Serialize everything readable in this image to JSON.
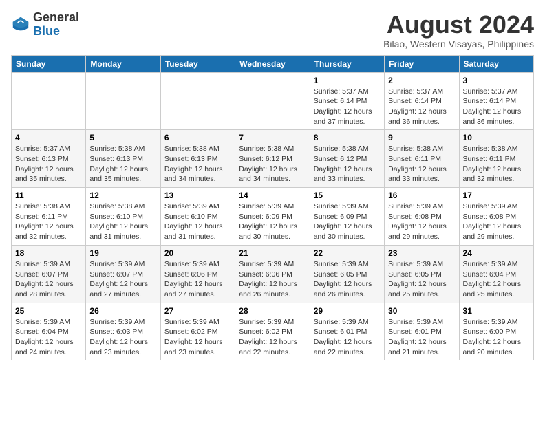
{
  "header": {
    "logo_general": "General",
    "logo_blue": "Blue",
    "title": "August 2024",
    "subtitle": "Bilao, Western Visayas, Philippines"
  },
  "calendar": {
    "days_of_week": [
      "Sunday",
      "Monday",
      "Tuesday",
      "Wednesday",
      "Thursday",
      "Friday",
      "Saturday"
    ],
    "weeks": [
      [
        {
          "day": "",
          "info": ""
        },
        {
          "day": "",
          "info": ""
        },
        {
          "day": "",
          "info": ""
        },
        {
          "day": "",
          "info": ""
        },
        {
          "day": "1",
          "info": "Sunrise: 5:37 AM\nSunset: 6:14 PM\nDaylight: 12 hours\nand 37 minutes."
        },
        {
          "day": "2",
          "info": "Sunrise: 5:37 AM\nSunset: 6:14 PM\nDaylight: 12 hours\nand 36 minutes."
        },
        {
          "day": "3",
          "info": "Sunrise: 5:37 AM\nSunset: 6:14 PM\nDaylight: 12 hours\nand 36 minutes."
        }
      ],
      [
        {
          "day": "4",
          "info": "Sunrise: 5:37 AM\nSunset: 6:13 PM\nDaylight: 12 hours\nand 35 minutes."
        },
        {
          "day": "5",
          "info": "Sunrise: 5:38 AM\nSunset: 6:13 PM\nDaylight: 12 hours\nand 35 minutes."
        },
        {
          "day": "6",
          "info": "Sunrise: 5:38 AM\nSunset: 6:13 PM\nDaylight: 12 hours\nand 34 minutes."
        },
        {
          "day": "7",
          "info": "Sunrise: 5:38 AM\nSunset: 6:12 PM\nDaylight: 12 hours\nand 34 minutes."
        },
        {
          "day": "8",
          "info": "Sunrise: 5:38 AM\nSunset: 6:12 PM\nDaylight: 12 hours\nand 33 minutes."
        },
        {
          "day": "9",
          "info": "Sunrise: 5:38 AM\nSunset: 6:11 PM\nDaylight: 12 hours\nand 33 minutes."
        },
        {
          "day": "10",
          "info": "Sunrise: 5:38 AM\nSunset: 6:11 PM\nDaylight: 12 hours\nand 32 minutes."
        }
      ],
      [
        {
          "day": "11",
          "info": "Sunrise: 5:38 AM\nSunset: 6:11 PM\nDaylight: 12 hours\nand 32 minutes."
        },
        {
          "day": "12",
          "info": "Sunrise: 5:38 AM\nSunset: 6:10 PM\nDaylight: 12 hours\nand 31 minutes."
        },
        {
          "day": "13",
          "info": "Sunrise: 5:39 AM\nSunset: 6:10 PM\nDaylight: 12 hours\nand 31 minutes."
        },
        {
          "day": "14",
          "info": "Sunrise: 5:39 AM\nSunset: 6:09 PM\nDaylight: 12 hours\nand 30 minutes."
        },
        {
          "day": "15",
          "info": "Sunrise: 5:39 AM\nSunset: 6:09 PM\nDaylight: 12 hours\nand 30 minutes."
        },
        {
          "day": "16",
          "info": "Sunrise: 5:39 AM\nSunset: 6:08 PM\nDaylight: 12 hours\nand 29 minutes."
        },
        {
          "day": "17",
          "info": "Sunrise: 5:39 AM\nSunset: 6:08 PM\nDaylight: 12 hours\nand 29 minutes."
        }
      ],
      [
        {
          "day": "18",
          "info": "Sunrise: 5:39 AM\nSunset: 6:07 PM\nDaylight: 12 hours\nand 28 minutes."
        },
        {
          "day": "19",
          "info": "Sunrise: 5:39 AM\nSunset: 6:07 PM\nDaylight: 12 hours\nand 27 minutes."
        },
        {
          "day": "20",
          "info": "Sunrise: 5:39 AM\nSunset: 6:06 PM\nDaylight: 12 hours\nand 27 minutes."
        },
        {
          "day": "21",
          "info": "Sunrise: 5:39 AM\nSunset: 6:06 PM\nDaylight: 12 hours\nand 26 minutes."
        },
        {
          "day": "22",
          "info": "Sunrise: 5:39 AM\nSunset: 6:05 PM\nDaylight: 12 hours\nand 26 minutes."
        },
        {
          "day": "23",
          "info": "Sunrise: 5:39 AM\nSunset: 6:05 PM\nDaylight: 12 hours\nand 25 minutes."
        },
        {
          "day": "24",
          "info": "Sunrise: 5:39 AM\nSunset: 6:04 PM\nDaylight: 12 hours\nand 25 minutes."
        }
      ],
      [
        {
          "day": "25",
          "info": "Sunrise: 5:39 AM\nSunset: 6:04 PM\nDaylight: 12 hours\nand 24 minutes."
        },
        {
          "day": "26",
          "info": "Sunrise: 5:39 AM\nSunset: 6:03 PM\nDaylight: 12 hours\nand 23 minutes."
        },
        {
          "day": "27",
          "info": "Sunrise: 5:39 AM\nSunset: 6:02 PM\nDaylight: 12 hours\nand 23 minutes."
        },
        {
          "day": "28",
          "info": "Sunrise: 5:39 AM\nSunset: 6:02 PM\nDaylight: 12 hours\nand 22 minutes."
        },
        {
          "day": "29",
          "info": "Sunrise: 5:39 AM\nSunset: 6:01 PM\nDaylight: 12 hours\nand 22 minutes."
        },
        {
          "day": "30",
          "info": "Sunrise: 5:39 AM\nSunset: 6:01 PM\nDaylight: 12 hours\nand 21 minutes."
        },
        {
          "day": "31",
          "info": "Sunrise: 5:39 AM\nSunset: 6:00 PM\nDaylight: 12 hours\nand 20 minutes."
        }
      ]
    ]
  }
}
